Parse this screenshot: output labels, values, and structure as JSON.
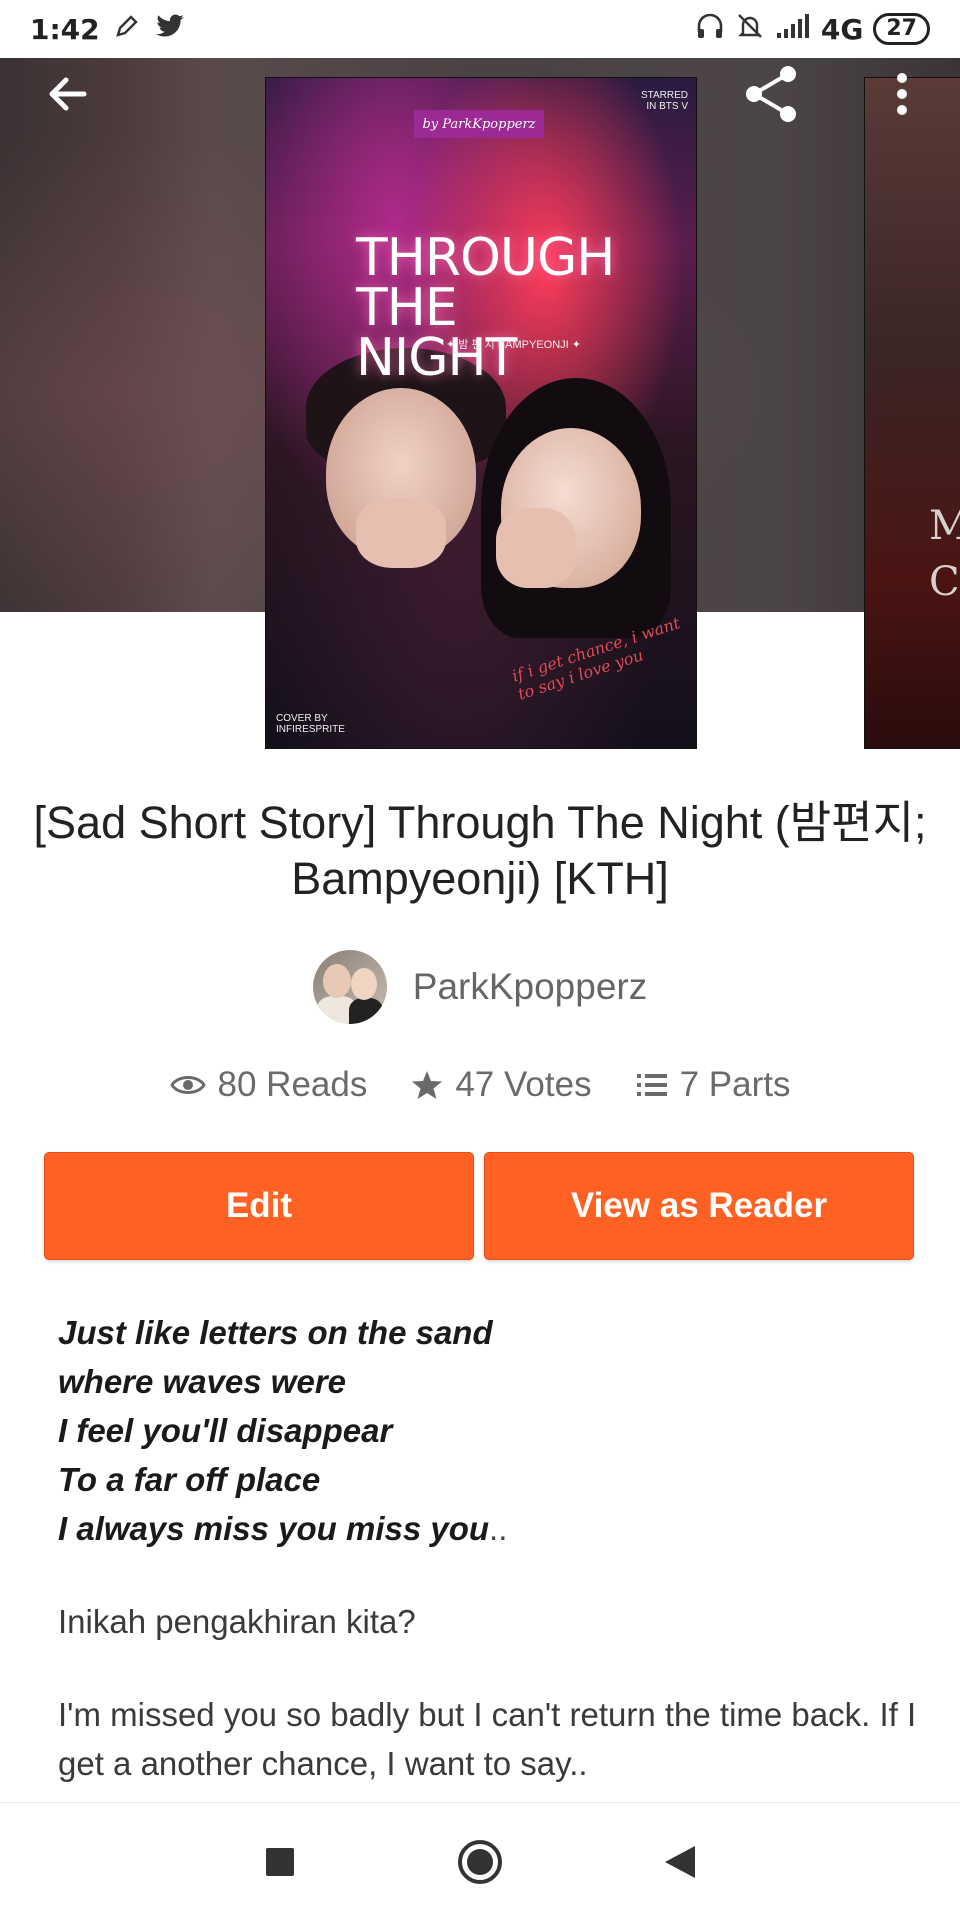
{
  "status_bar": {
    "time": "1:42",
    "network": "4G",
    "battery": "27"
  },
  "header": {
    "back_icon": "arrow-left-icon",
    "share_icon": "share-icon",
    "more_icon": "more-vertical-icon"
  },
  "cover": {
    "banner": "by ParkKpopperz",
    "title_line1": "THROUGH",
    "title_line2": "THE NIGHT",
    "subtitle": "✦ 밤 편 지 BAMPYEONJI ✦",
    "starred": "STARRED IN BTS V",
    "credit": "COVER BY INFIRESPRITE",
    "script": "if i get chance, i want to say i love you"
  },
  "next_cover": {
    "visible_text": "M C"
  },
  "story": {
    "title": "[Sad Short Story] Through The Night (밤편지; Bampyeonji) [KTH]",
    "author": "ParkKpopperz",
    "reads": "80 Reads",
    "votes": "47 Votes",
    "parts": "7 Parts"
  },
  "actions": {
    "edit": "Edit",
    "view_as_reader": "View as Reader"
  },
  "description": {
    "verse": [
      "Just like letters on the sand",
      "where waves were",
      "I feel you'll disappear",
      "To a far off place",
      "I always miss you miss you"
    ],
    "verse_tail": "..",
    "paragraph1": "Inikah pengakhiran kita?",
    "paragraph2": "I'm missed you so badly but I can't return the time back. If I get a another chance, I want to say.."
  },
  "colors": {
    "accent": "#ff6122",
    "text": "#222222",
    "muted": "#6a6a6a"
  }
}
